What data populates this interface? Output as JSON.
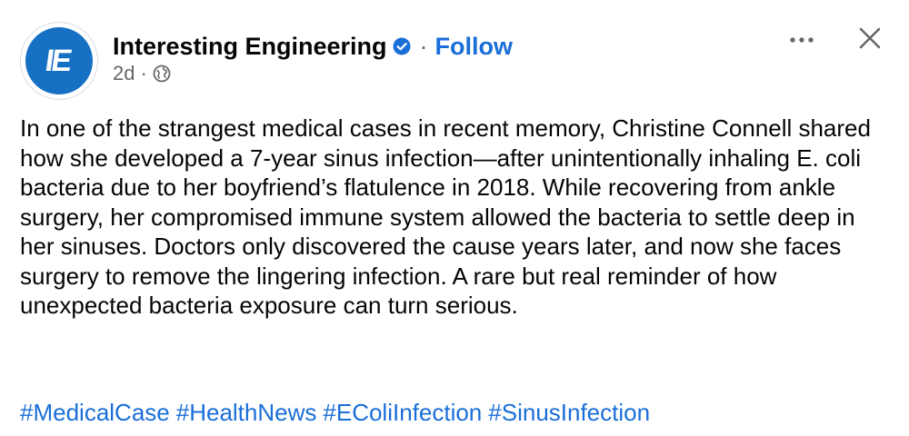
{
  "post": {
    "page_name": "Interesting Engineering",
    "avatar_text": "IE",
    "separator": "·",
    "follow_label": "Follow",
    "timestamp": "2d",
    "meta_separator": "·",
    "body_text": "In one of the strangest medical cases in recent memory, Christine Connell shared how she developed a 7-year sinus infection—after unintentionally inhaling E. coli bacteria due to her boyfriend’s flatulence in 2018. While recovering from ankle surgery, her compromised immune system allowed the bacteria to settle deep in her sinuses. Doctors only discovered the cause years later, and now she faces surgery to remove the lingering infection. A rare but real reminder of how unexpected bacteria exposure can turn serious.",
    "hashtags": [
      "#MedicalCase",
      "#HealthNews",
      "#EColiInfection",
      "#SinusInfection"
    ]
  },
  "icons": {
    "verified": "verified-badge-icon",
    "audience": "globe-icon",
    "more": "more-options-icon",
    "close": "close-icon"
  },
  "colors": {
    "link": "#1a6ed8",
    "brand": "#1670c4",
    "secondary_text": "#65676b"
  }
}
